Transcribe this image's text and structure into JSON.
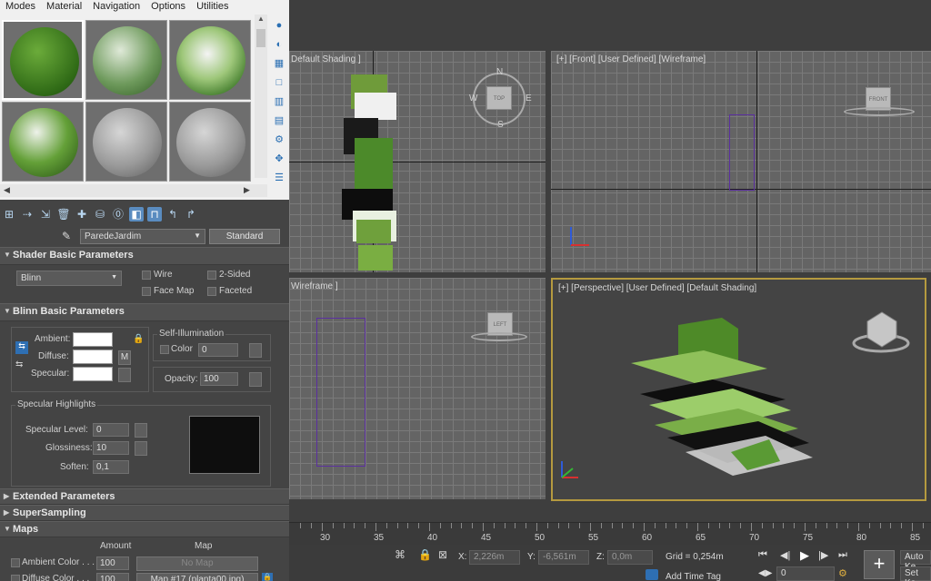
{
  "menubar": {
    "items": [
      "Modes",
      "Material",
      "Navigation",
      "Options",
      "Utilities"
    ]
  },
  "sample_slots": [
    {
      "name": "slot-1",
      "material": "grass"
    },
    {
      "name": "slot-2",
      "material": "fern"
    },
    {
      "name": "slot-3",
      "material": "leaves"
    },
    {
      "name": "slot-4",
      "material": "ivy"
    },
    {
      "name": "slot-5",
      "material": "default"
    },
    {
      "name": "slot-6",
      "material": "default"
    }
  ],
  "material": {
    "name": "ParedeJardim",
    "type": "Standard"
  },
  "shader_basic": {
    "title": "Shader Basic Parameters",
    "shader": "Blinn",
    "wire": "Wire",
    "two_sided": "2-Sided",
    "face_map": "Face Map",
    "faceted": "Faceted"
  },
  "blinn_basic": {
    "title": "Blinn Basic Parameters",
    "self_illum_title": "Self-Illumination",
    "color_label": "Color",
    "color_value": "0",
    "ambient": "Ambient:",
    "diffuse": "Diffuse:",
    "specular": "Specular:",
    "m_button": "M",
    "opacity_label": "Opacity:",
    "opacity_value": "100"
  },
  "specular_highlights": {
    "title": "Specular Highlights",
    "level_label": "Specular Level:",
    "level_value": "0",
    "gloss_label": "Glossiness:",
    "gloss_value": "10",
    "soften_label": "Soften:",
    "soften_value": "0,1"
  },
  "rollouts": {
    "extended": "Extended Parameters",
    "supersampling": "SuperSampling",
    "maps": "Maps"
  },
  "maps": {
    "amount_header": "Amount",
    "map_header": "Map",
    "rows": [
      {
        "label": "Ambient Color . . .",
        "amount": "100",
        "map": "No Map"
      },
      {
        "label": "Diffuse Color . . .",
        "amount": "100",
        "map": "Map #17 (planta00.jpg)"
      }
    ]
  },
  "viewports": {
    "top": {
      "label": "Default Shading ]",
      "cube": "TOP",
      "compass": [
        "N",
        "E",
        "S",
        "W"
      ]
    },
    "front": {
      "label": "[+] [Front] [User Defined] [Wireframe]",
      "cube": "FRONT"
    },
    "left": {
      "label": "Wireframe ]",
      "cube": "LEFT"
    },
    "perspective": {
      "label": "[+] [Perspective] [User Defined] [Default Shading]"
    }
  },
  "timeline": {
    "ticks": [
      "30",
      "35",
      "40",
      "45",
      "50",
      "55",
      "60",
      "65",
      "70",
      "75",
      "80",
      "85"
    ]
  },
  "status": {
    "x_label": "X:",
    "x_value": "2,226m",
    "y_label": "Y:",
    "y_value": "-6,561m",
    "z_label": "Z:",
    "z_value": "0,0m",
    "grid": "Grid = 0,254m",
    "add_time_tag": "Add Time Tag",
    "frame_value": "0",
    "auto_key": "Auto Ke",
    "set_key": "Set Ke"
  }
}
